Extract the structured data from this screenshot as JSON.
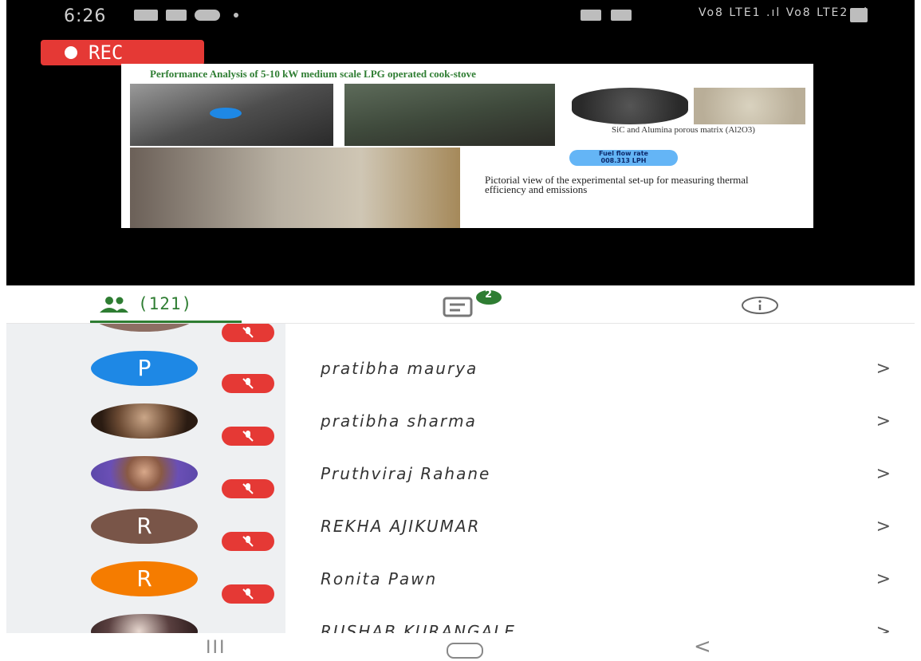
{
  "status_bar": {
    "time": "6:26",
    "right_text": "Vo8 LTE1 .ıl Vo8 LTE2 .ıl"
  },
  "recording": {
    "label": "REC"
  },
  "slide": {
    "title": "Performance Analysis of 5-10 kW medium scale LPG operated cook-stove",
    "caption_porous": "SiC and Alumina porous matrix (Al2O3)",
    "fuel_flow_label": "Fuel flow rate",
    "fuel_flow_value": "008.313 LPH",
    "caption_setup": "Pictorial view of the experimental set-up for measuring thermal efficiency and emissions"
  },
  "tabs": {
    "participants_count": "(121)",
    "chat_badge": "2"
  },
  "colors": {
    "accent_green": "#2e7d32",
    "muted_red": "#e53935",
    "avatar_blue": "#1e88e5",
    "avatar_brown": "#795548",
    "avatar_orange": "#f57c00"
  },
  "participants": [
    {
      "initial": "P",
      "name": "pratibha maurya"
    },
    {
      "initial": "",
      "name": "pratibha sharma"
    },
    {
      "initial": "",
      "name": "Pruthviraj Rahane"
    },
    {
      "initial": "R",
      "name": "REKHA AJIKUMAR"
    },
    {
      "initial": "R",
      "name": "Ronita Pawn"
    },
    {
      "initial": "",
      "name": "RUSHAB KURANGALE"
    }
  ],
  "chevron": ">",
  "nav": {
    "recents": "III",
    "back": "<"
  }
}
